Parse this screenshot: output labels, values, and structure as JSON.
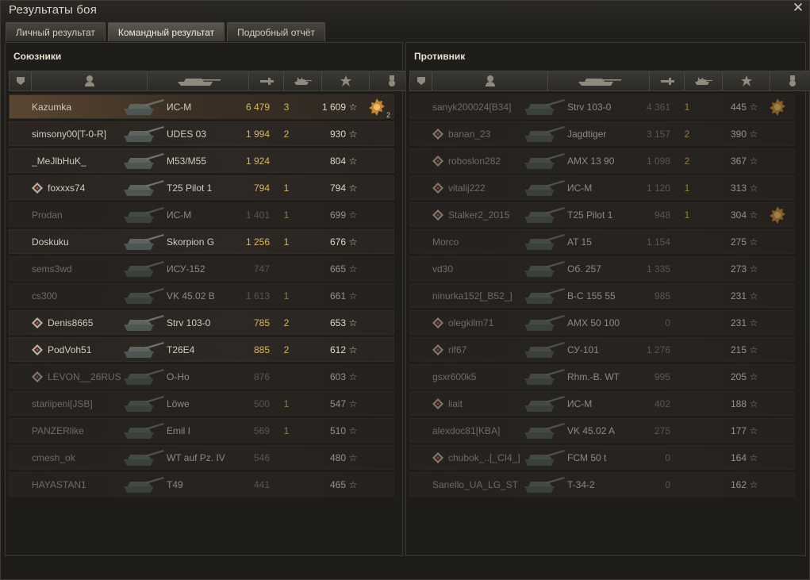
{
  "window": {
    "title": "Результаты боя",
    "close_label": "✕"
  },
  "tabs": [
    {
      "label": "Личный результат",
      "active": false
    },
    {
      "label": "Командный результат",
      "active": true
    },
    {
      "label": "Подробный отчёт",
      "active": false
    }
  ],
  "allies": {
    "title": "Союзники",
    "players": [
      {
        "name": "Kazumka",
        "platoon": false,
        "vehicle": "ИС-М",
        "damage": "6 479",
        "kills": "3",
        "xp": "1 609",
        "medal": true,
        "medal_count": "2",
        "me": true,
        "alive": true,
        "damage_gold": true
      },
      {
        "name": "simsony00[T-0-R]",
        "platoon": false,
        "vehicle": "UDES 03",
        "damage": "1 994",
        "kills": "2",
        "xp": "930",
        "medal": false,
        "alive": true,
        "damage_gold": true
      },
      {
        "name": "_MeJlbHuK_",
        "platoon": false,
        "vehicle": "M53/M55",
        "damage": "1 924",
        "kills": "",
        "xp": "804",
        "medal": false,
        "alive": true,
        "damage_gold": true
      },
      {
        "name": "foxxxs74",
        "platoon": true,
        "vehicle": "T25 Pilot 1",
        "damage": "794",
        "kills": "1",
        "xp": "794",
        "medal": false,
        "alive": true,
        "damage_gold": true
      },
      {
        "name": "Prodan",
        "platoon": false,
        "vehicle": "ИС-М",
        "damage": "1 401",
        "kills": "1",
        "xp": "699",
        "medal": false,
        "alive": false,
        "damage_gold": false
      },
      {
        "name": "Doskuku",
        "platoon": false,
        "vehicle": "Skorpion G",
        "damage": "1 256",
        "kills": "1",
        "xp": "676",
        "medal": false,
        "alive": true,
        "damage_gold": true
      },
      {
        "name": "sems3wd",
        "platoon": false,
        "vehicle": "ИСУ-152",
        "damage": "747",
        "kills": "",
        "xp": "665",
        "medal": false,
        "alive": false,
        "damage_gold": false
      },
      {
        "name": "cs300",
        "platoon": false,
        "vehicle": "VK 45.02 B",
        "damage": "1 613",
        "kills": "1",
        "xp": "661",
        "medal": false,
        "alive": false,
        "damage_gold": false
      },
      {
        "name": "Denis8665",
        "platoon": true,
        "vehicle": "Strv 103-0",
        "damage": "785",
        "kills": "2",
        "xp": "653",
        "medal": false,
        "alive": true,
        "damage_gold": true
      },
      {
        "name": "PodVoh51",
        "platoon": true,
        "vehicle": "T26E4",
        "damage": "885",
        "kills": "2",
        "xp": "612",
        "medal": false,
        "alive": true,
        "damage_gold": true
      },
      {
        "name": "LEVON__26RUS",
        "platoon": true,
        "vehicle": "O-Ho",
        "damage": "876",
        "kills": "",
        "xp": "603",
        "medal": false,
        "alive": false,
        "damage_gold": false
      },
      {
        "name": "stariipeni[JSB]",
        "platoon": false,
        "vehicle": "Löwe",
        "damage": "500",
        "kills": "1",
        "xp": "547",
        "medal": false,
        "alive": false,
        "damage_gold": false
      },
      {
        "name": "PANZERlike",
        "platoon": false,
        "vehicle": "Emil I",
        "damage": "569",
        "kills": "1",
        "xp": "510",
        "medal": false,
        "alive": false,
        "damage_gold": false
      },
      {
        "name": "cmesh_ok",
        "platoon": false,
        "vehicle": "WT auf Pz. IV",
        "damage": "546",
        "kills": "",
        "xp": "480",
        "medal": false,
        "alive": false,
        "damage_gold": false
      },
      {
        "name": "HAYASTAN1",
        "platoon": false,
        "vehicle": "T49",
        "damage": "441",
        "kills": "",
        "xp": "465",
        "medal": false,
        "alive": false,
        "damage_gold": false
      }
    ]
  },
  "enemies": {
    "title": "Противник",
    "players": [
      {
        "name": "sanyk200024[B34]",
        "platoon": false,
        "vehicle": "Strv 103-0",
        "damage": "4 361",
        "kills": "1",
        "xp": "445",
        "medal": true,
        "alive": false,
        "damage_gold": false
      },
      {
        "name": "banan_23",
        "platoon": true,
        "vehicle": "Jagdtiger",
        "damage": "3 157",
        "kills": "2",
        "xp": "390",
        "medal": false,
        "alive": false,
        "damage_gold": false
      },
      {
        "name": "roboslon282",
        "platoon": true,
        "vehicle": "AMX 13 90",
        "damage": "1 098",
        "kills": "2",
        "xp": "367",
        "medal": false,
        "alive": false,
        "damage_gold": false
      },
      {
        "name": "vitalij222",
        "platoon": true,
        "vehicle": "ИС-М",
        "damage": "1 120",
        "kills": "1",
        "xp": "313",
        "medal": false,
        "alive": false,
        "damage_gold": false
      },
      {
        "name": "Stalker2_2015",
        "platoon": true,
        "vehicle": "T25 Pilot 1",
        "damage": "948",
        "kills": "1",
        "xp": "304",
        "medal": true,
        "alive": false,
        "damage_gold": false
      },
      {
        "name": "Morco",
        "platoon": false,
        "vehicle": "AT 15",
        "damage": "1 154",
        "kills": "",
        "xp": "275",
        "medal": false,
        "alive": false,
        "damage_gold": false
      },
      {
        "name": "vd30",
        "platoon": false,
        "vehicle": "Об. 257",
        "damage": "1 335",
        "kills": "",
        "xp": "273",
        "medal": false,
        "alive": false,
        "damage_gold": false
      },
      {
        "name": "ninurka152[_B52_]",
        "platoon": false,
        "vehicle": "B-C 155 55",
        "damage": "985",
        "kills": "",
        "xp": "231",
        "medal": false,
        "alive": false,
        "damage_gold": false
      },
      {
        "name": "olegkilm71",
        "platoon": true,
        "vehicle": "AMX 50 100",
        "damage": "0",
        "kills": "",
        "xp": "231",
        "medal": false,
        "alive": false,
        "damage_gold": false
      },
      {
        "name": "rif67",
        "platoon": true,
        "vehicle": "СУ-101",
        "damage": "1 276",
        "kills": "",
        "xp": "215",
        "medal": false,
        "alive": false,
        "damage_gold": false
      },
      {
        "name": "gsxr600k5",
        "platoon": false,
        "vehicle": "Rhm.-B. WT",
        "damage": "995",
        "kills": "",
        "xp": "205",
        "medal": false,
        "alive": false,
        "damage_gold": false
      },
      {
        "name": "liait",
        "platoon": true,
        "vehicle": "ИС-М",
        "damage": "402",
        "kills": "",
        "xp": "188",
        "medal": false,
        "alive": false,
        "damage_gold": false
      },
      {
        "name": "alexdoc81[KBA]",
        "platoon": false,
        "vehicle": "VK 45.02 A",
        "damage": "275",
        "kills": "",
        "xp": "177",
        "medal": false,
        "alive": false,
        "damage_gold": false
      },
      {
        "name": "chubok_..[_CI4_]",
        "platoon": true,
        "vehicle": "FCM 50 t",
        "damage": "0",
        "kills": "",
        "xp": "164",
        "medal": false,
        "alive": false,
        "damage_gold": false
      },
      {
        "name": "Sanello_UA_LG_ST",
        "platoon": false,
        "vehicle": "T-34-2",
        "damage": "0",
        "kills": "",
        "xp": "162",
        "medal": false,
        "alive": false,
        "damage_gold": false
      }
    ]
  },
  "icons": {
    "platoon": "platoon-icon",
    "player": "player-icon",
    "tank": "tank-icon",
    "damage": "damage-icon",
    "kills": "kills-icon",
    "xp": "star-icon",
    "medal": "medal-icon"
  },
  "colors": {
    "damage_gold": "#d8b75a",
    "my_row": "#5a4632"
  }
}
